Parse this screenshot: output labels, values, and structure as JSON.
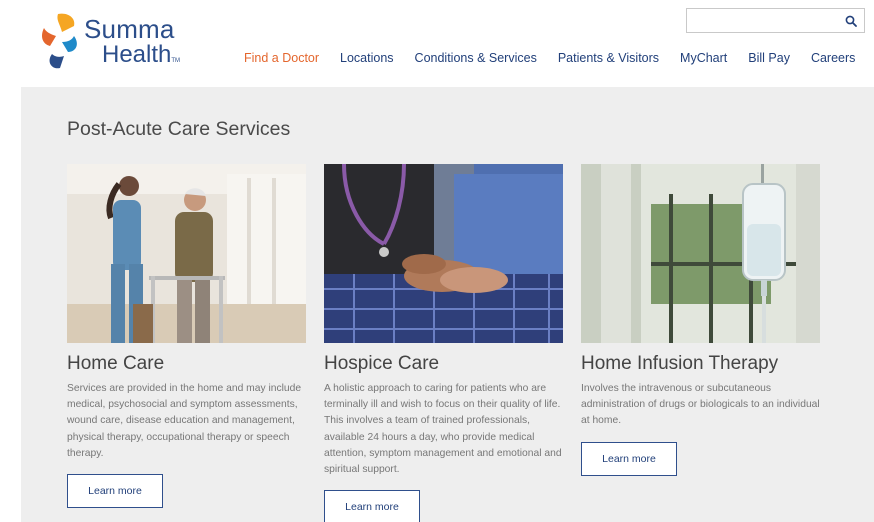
{
  "brand": {
    "name_line1": "Summa",
    "name_line2": "Health",
    "trademark": "TM"
  },
  "search": {
    "placeholder": "",
    "value": ""
  },
  "nav": {
    "items": [
      {
        "label": "Find a Doctor"
      },
      {
        "label": "Locations"
      },
      {
        "label": "Conditions & Services"
      },
      {
        "label": "Patients & Visitors"
      },
      {
        "label": "MyChart"
      },
      {
        "label": "Bill Pay"
      },
      {
        "label": "Careers"
      }
    ]
  },
  "section": {
    "title": "Post-Acute Care Services"
  },
  "cards": [
    {
      "title": "Home Care",
      "description": "Services are provided in the home and may include medical, psychosocial and symptom assessments, wound care, disease education and management, physical therapy, occupational therapy or speech therapy.",
      "button": "Learn more"
    },
    {
      "title": "Hospice Care",
      "description": "A holistic approach to caring for patients who are terminally ill and wish to focus on their quality of life. This involves a team of trained professionals, available 24 hours a day, who provide medical attention, symptom management and emotional and spiritual support.",
      "button": "Learn more"
    },
    {
      "title": "Home Infusion Therapy",
      "description": "Involves the intravenous or subcutaneous administration of drugs or biologicals to an individual at home.",
      "button": "Learn more"
    }
  ],
  "colors": {
    "brand_blue": "#2c4e8a",
    "nav_blue": "#22407a",
    "accent_orange": "#e4662d",
    "panel_gray": "#eeeeee"
  },
  "icons": {
    "search": "magnifier-icon",
    "logo": "summa-pinwheel-logo"
  }
}
